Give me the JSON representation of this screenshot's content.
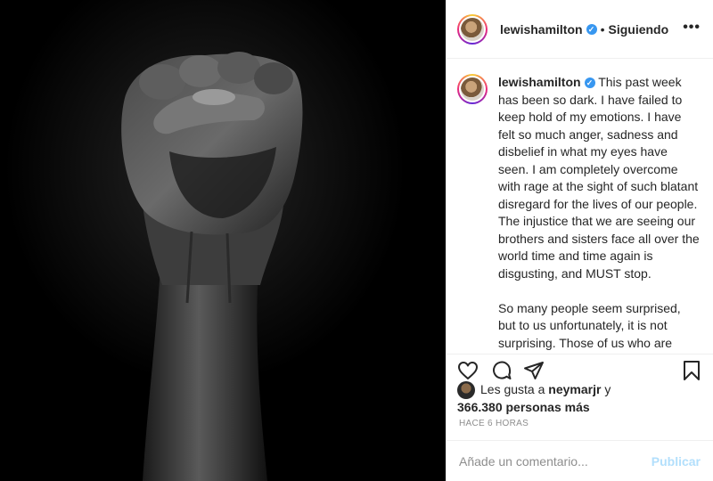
{
  "post": {
    "username": "lewishamilton",
    "separator": "•",
    "follow_status": "Siguiendo",
    "more_icon": "more-options-icon",
    "caption": [
      "This past week has been so dark. I have failed to keep hold of my emotions. I have felt so much anger, sadness and disbelief in what my eyes have seen. I am completely overcome with rage at the sight of such blatant disregard for the lives of our people. The injustice that we are seeing our brothers and sisters face all over the world time and time again is disgusting, and MUST stop.",
      "So many people seem surprised, but to us unfortunately, it is not surprising. Those of us who are black, brown or in between, see it everyday and should not have to feel as though we were born guilty, don't"
    ],
    "likes": {
      "prefix": "Les gusta a",
      "user": "neymarjr",
      "and": "y",
      "count_text": "366.380 personas más"
    },
    "timestamp": "HACE 6 HORAS",
    "comment": {
      "placeholder": "Añade un comentario...",
      "publish_label": "Publicar"
    }
  },
  "icons": {
    "verified": "verified-badge-icon",
    "like": "heart-icon",
    "comment": "comment-bubble-icon",
    "share": "paper-plane-icon",
    "save": "bookmark-icon"
  },
  "colors": {
    "verified": "#3897f0",
    "publish_disabled": "#b2dffc",
    "muted": "#8e8e8e",
    "text": "#262626",
    "photo_background": "#000000"
  }
}
